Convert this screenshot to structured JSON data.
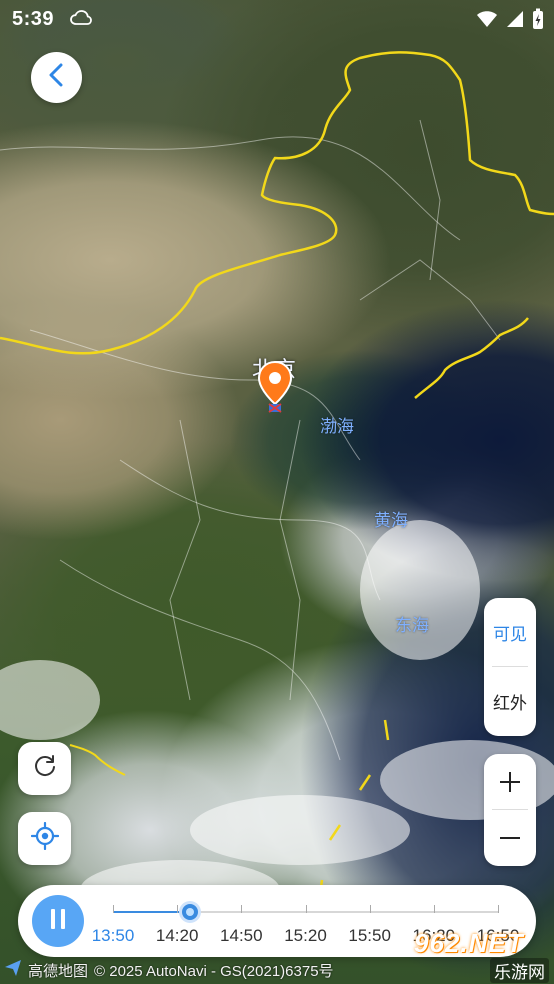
{
  "status_bar": {
    "time": "5:39",
    "icons": [
      "cloud-icon",
      "wifi-icon",
      "signal-icon",
      "battery-charging-icon"
    ]
  },
  "map": {
    "city": "北京",
    "seas": {
      "bohai": "渤海",
      "huanghai": "黄海",
      "donghai": "东海"
    },
    "border_color": "#f2d81a"
  },
  "controls": {
    "back_icon": "chevron-left-icon",
    "refresh_icon": "refresh-icon",
    "locate_icon": "crosshair-icon",
    "layer_visible": "可见",
    "layer_infrared": "红外",
    "zoom_in": "+",
    "zoom_out": "−",
    "accent": "#2e86e6"
  },
  "timeline": {
    "play_state_icon": "pause-icon",
    "times": [
      "13:50",
      "14:20",
      "14:50",
      "15:20",
      "15:50",
      "16:20",
      "16:50"
    ],
    "active_time": "13:50",
    "progress_fraction": 0.2
  },
  "attribution": {
    "provider": "高德地图",
    "copyright": "© 2025 AutoNavi - GS(2021)6375号"
  },
  "watermark": {
    "brand": "962.NET",
    "site": "乐游网"
  }
}
